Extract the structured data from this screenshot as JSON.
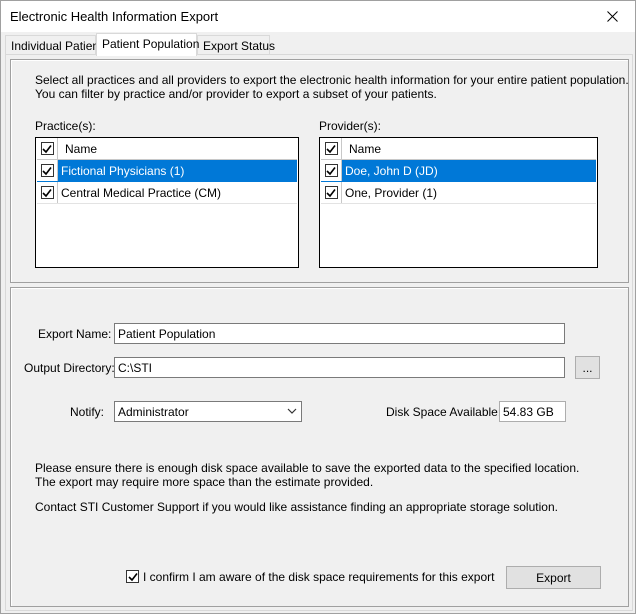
{
  "window": {
    "title": "Electronic Health Information Export"
  },
  "tabs": [
    {
      "label": "Individual Patient"
    },
    {
      "label": "Patient Population"
    },
    {
      "label": "Export Status"
    }
  ],
  "selection": {
    "instructions_line1": "Select all practices and all providers to export the electronic health information for your entire patient population.",
    "instructions_line2": "You can filter by practice and/or provider to export a subset of your patients.",
    "practices": {
      "label": "Practice(s):",
      "header": "Name",
      "rows": [
        {
          "name": "Fictional Physicians (1)",
          "checked": true,
          "selected": true
        },
        {
          "name": "Central Medical Practice (CM)",
          "checked": true,
          "selected": false
        }
      ]
    },
    "providers": {
      "label": "Provider(s):",
      "header": "Name",
      "rows": [
        {
          "name": "Doe, John D (JD)",
          "checked": true,
          "selected": true
        },
        {
          "name": "One, Provider  (1)",
          "checked": true,
          "selected": false
        }
      ]
    }
  },
  "export": {
    "name_label": "Export Name:",
    "name_value": "Patient Population",
    "dir_label": "Output Directory:",
    "dir_value": "C:\\STI",
    "browse_label": "...",
    "notify_label": "Notify:",
    "notify_value": "Administrator",
    "disk_label": "Disk Space Available:",
    "disk_value": "54.83 GB",
    "warning_line1": "Please ensure there is enough disk space available to save the exported data to the specified location.",
    "warning_line2": "The export may require more space than the estimate provided.",
    "support_text": "Contact STI Customer Support if you would like assistance finding an appropriate storage solution.",
    "confirm_label": "I confirm I am aware of the disk space requirements for this export",
    "confirm_checked": true,
    "export_button": "Export"
  },
  "colors": {
    "selection": "#0078d7",
    "window_bg": "#f0f0f0"
  }
}
